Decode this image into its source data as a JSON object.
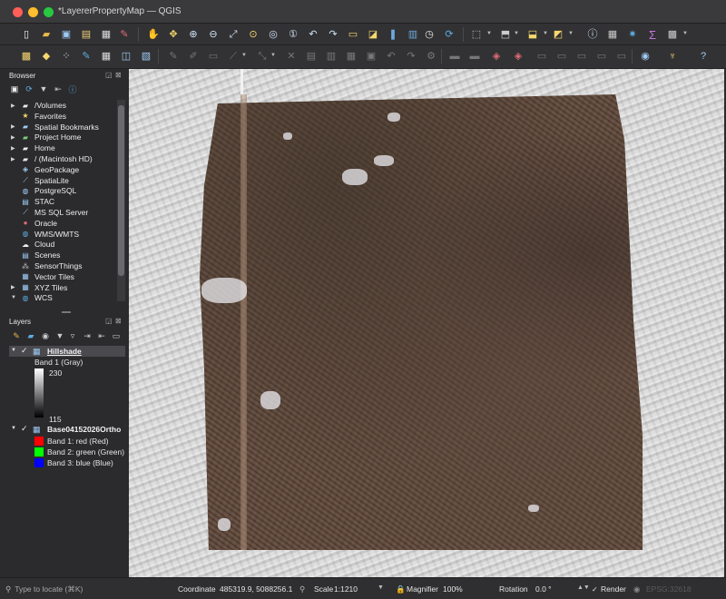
{
  "window": {
    "title": "*LayererPropertyMap — QGIS"
  },
  "browser": {
    "title": "Browser",
    "items": [
      {
        "label": "/Volumes",
        "icon": "folder-icon",
        "expandable": true
      },
      {
        "label": "Favorites",
        "icon": "star-icon",
        "expandable": false
      },
      {
        "label": "Spatial Bookmarks",
        "icon": "bookmark-icon",
        "expandable": true
      },
      {
        "label": "Project Home",
        "icon": "project-folder-icon",
        "expandable": true
      },
      {
        "label": "Home",
        "icon": "folder-icon",
        "expandable": true
      },
      {
        "label": "/ (Macintosh HD)",
        "icon": "folder-icon",
        "expandable": true
      },
      {
        "label": "GeoPackage",
        "icon": "geopackage-icon",
        "expandable": false
      },
      {
        "label": "SpatiaLite",
        "icon": "spatialite-icon",
        "expandable": false
      },
      {
        "label": "PostgreSQL",
        "icon": "postgresql-icon",
        "expandable": false
      },
      {
        "label": "STAC",
        "icon": "stac-icon",
        "expandable": false
      },
      {
        "label": "MS SQL Server",
        "icon": "mssql-icon",
        "expandable": false
      },
      {
        "label": "Oracle",
        "icon": "oracle-icon",
        "expandable": false
      },
      {
        "label": "WMS/WMTS",
        "icon": "globe-icon",
        "expandable": false
      },
      {
        "label": "Cloud",
        "icon": "cloud-icon",
        "expandable": false
      },
      {
        "label": "Scenes",
        "icon": "scenes-icon",
        "expandable": false
      },
      {
        "label": "SensorThings",
        "icon": "sensorthings-icon",
        "expandable": false
      },
      {
        "label": "Vector Tiles",
        "icon": "vector-tiles-icon",
        "expandable": false
      },
      {
        "label": "XYZ Tiles",
        "icon": "xyz-tiles-icon",
        "expandable": true
      },
      {
        "label": "WCS",
        "icon": "globe-icon",
        "expandable": true
      }
    ]
  },
  "layers": {
    "title": "Layers",
    "hillshade": {
      "name": "Hillshade",
      "band": "Band 1 (Gray)",
      "max": "230",
      "min": "115"
    },
    "ortho": {
      "name": "Base04152026Ortho",
      "bands": [
        {
          "label": "Band 1: red (Red)",
          "color": "#ff0000"
        },
        {
          "label": "Band 2: green (Green)",
          "color": "#00ff00"
        },
        {
          "label": "Band 3: blue (Blue)",
          "color": "#0000ff"
        }
      ]
    }
  },
  "status": {
    "locator_placeholder": "Type to locate (⌘K)",
    "coordinate_label": "Coordinate",
    "coordinate_value": "485319.9, 5088256.1",
    "scale_label": "Scale",
    "scale_value": "1:1210",
    "magnifier_label": "Magnifier",
    "magnifier_value": "100%",
    "rotation_label": "Rotation",
    "rotation_value": "0.0 °",
    "render_label": "Render",
    "crs_label": "EPSG:32618"
  },
  "colors": {
    "accent": "#3d7fd9",
    "panel": "#2b2b2d",
    "toolbar": "#323234"
  }
}
